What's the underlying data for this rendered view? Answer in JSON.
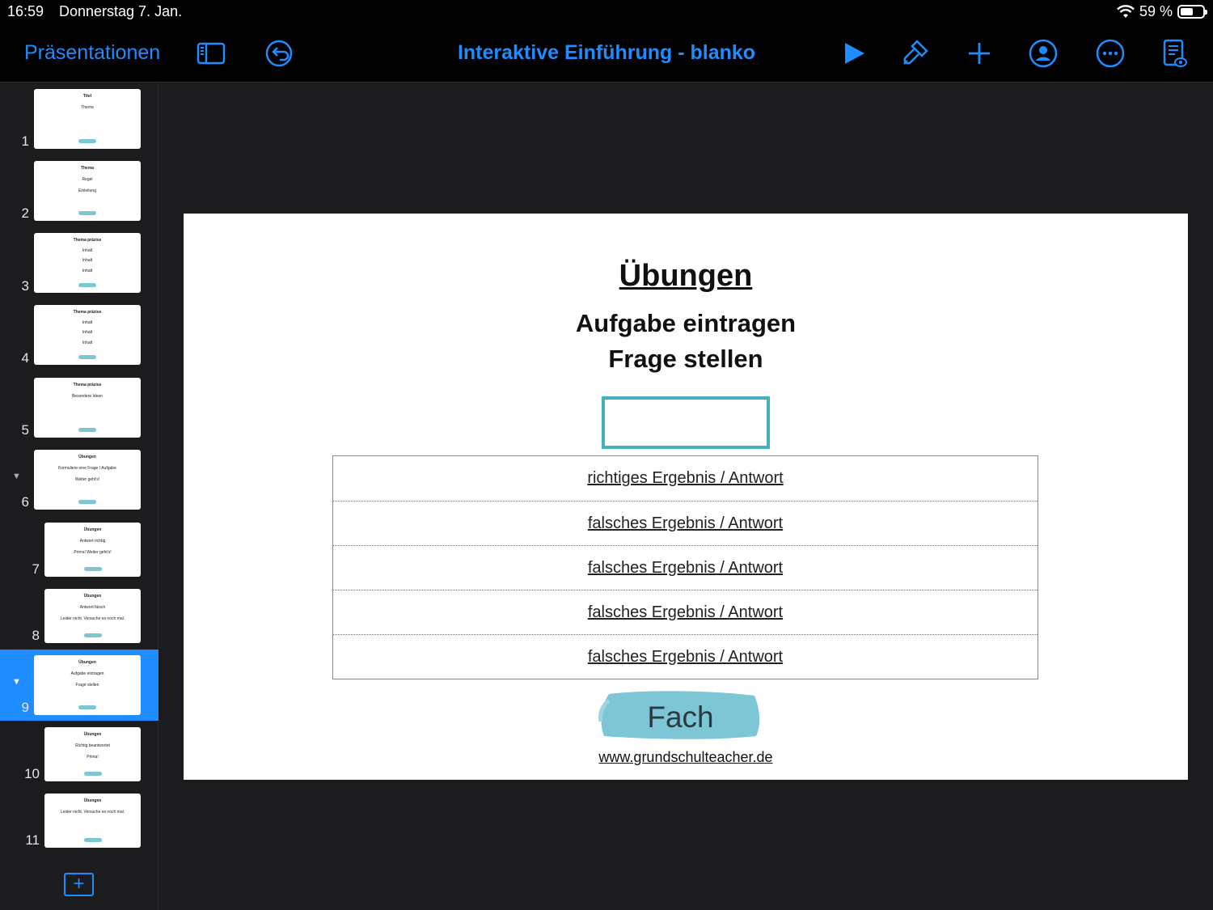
{
  "status": {
    "time": "16:59",
    "date": "Donnerstag 7. Jan.",
    "battery": "59 %",
    "battery_level": 0.59
  },
  "toolbar": {
    "back_label": "Präsentationen",
    "title": "Interaktive Einführung - blanko",
    "icons": [
      "sidebar-icon",
      "undo-icon",
      "play-icon",
      "format-brush-icon",
      "add-icon",
      "collaborate-icon",
      "more-icon",
      "presenter-notes-icon"
    ]
  },
  "sidebar": {
    "selected": 9,
    "slides": [
      {
        "num": "1",
        "lines": [
          "Titel",
          "Thema"
        ]
      },
      {
        "num": "2",
        "lines": [
          "Thema",
          "Regel",
          "Einleitung"
        ]
      },
      {
        "num": "3",
        "lines": [
          "Thema präzise",
          "Inhalt",
          "Inhalt",
          "Inhalt"
        ]
      },
      {
        "num": "4",
        "lines": [
          "Thema präzise",
          "Inhalt",
          "Inhalt",
          "Inhalt"
        ]
      },
      {
        "num": "5",
        "lines": [
          "Thema präzise",
          "Besondere Ideen"
        ]
      },
      {
        "num": "6",
        "lines": [
          "Übungen",
          "Formuliere eine Frage / Aufgabe",
          "Weiter geht's!"
        ]
      },
      {
        "num": "7",
        "lines": [
          "Übungen",
          "Antwort richtig",
          "Prima! Weiter geht's!"
        ]
      },
      {
        "num": "8",
        "lines": [
          "Übungen",
          "Antwort falsch",
          "Leider nicht. Versuche es noch mal."
        ]
      },
      {
        "num": "9",
        "lines": [
          "Übungen",
          "Aufgabe eintragen",
          "Frage stellen"
        ]
      },
      {
        "num": "10",
        "lines": [
          "Übungen",
          "Richtig beantwortet",
          "Prima!"
        ]
      },
      {
        "num": "11",
        "lines": [
          "Übungen",
          "Leider nicht. Versuche es noch mal."
        ]
      }
    ],
    "add_label": "+"
  },
  "slide": {
    "title": "Übungen",
    "subtitle1": "Aufgabe eintragen",
    "subtitle2": "Frage stellen",
    "answers": [
      "richtiges Ergebnis / Antwort",
      "falsches Ergebnis / Antwort",
      "falsches Ergebnis / Antwort",
      "falsches Ergebnis / Antwort",
      "falsches Ergebnis / Antwort"
    ],
    "subject": "Fach",
    "url": "www.grundschulteacher.de"
  },
  "colors": {
    "accent": "#1f8cff",
    "box_border": "#45aebf",
    "brush": "#7cc6d6"
  }
}
